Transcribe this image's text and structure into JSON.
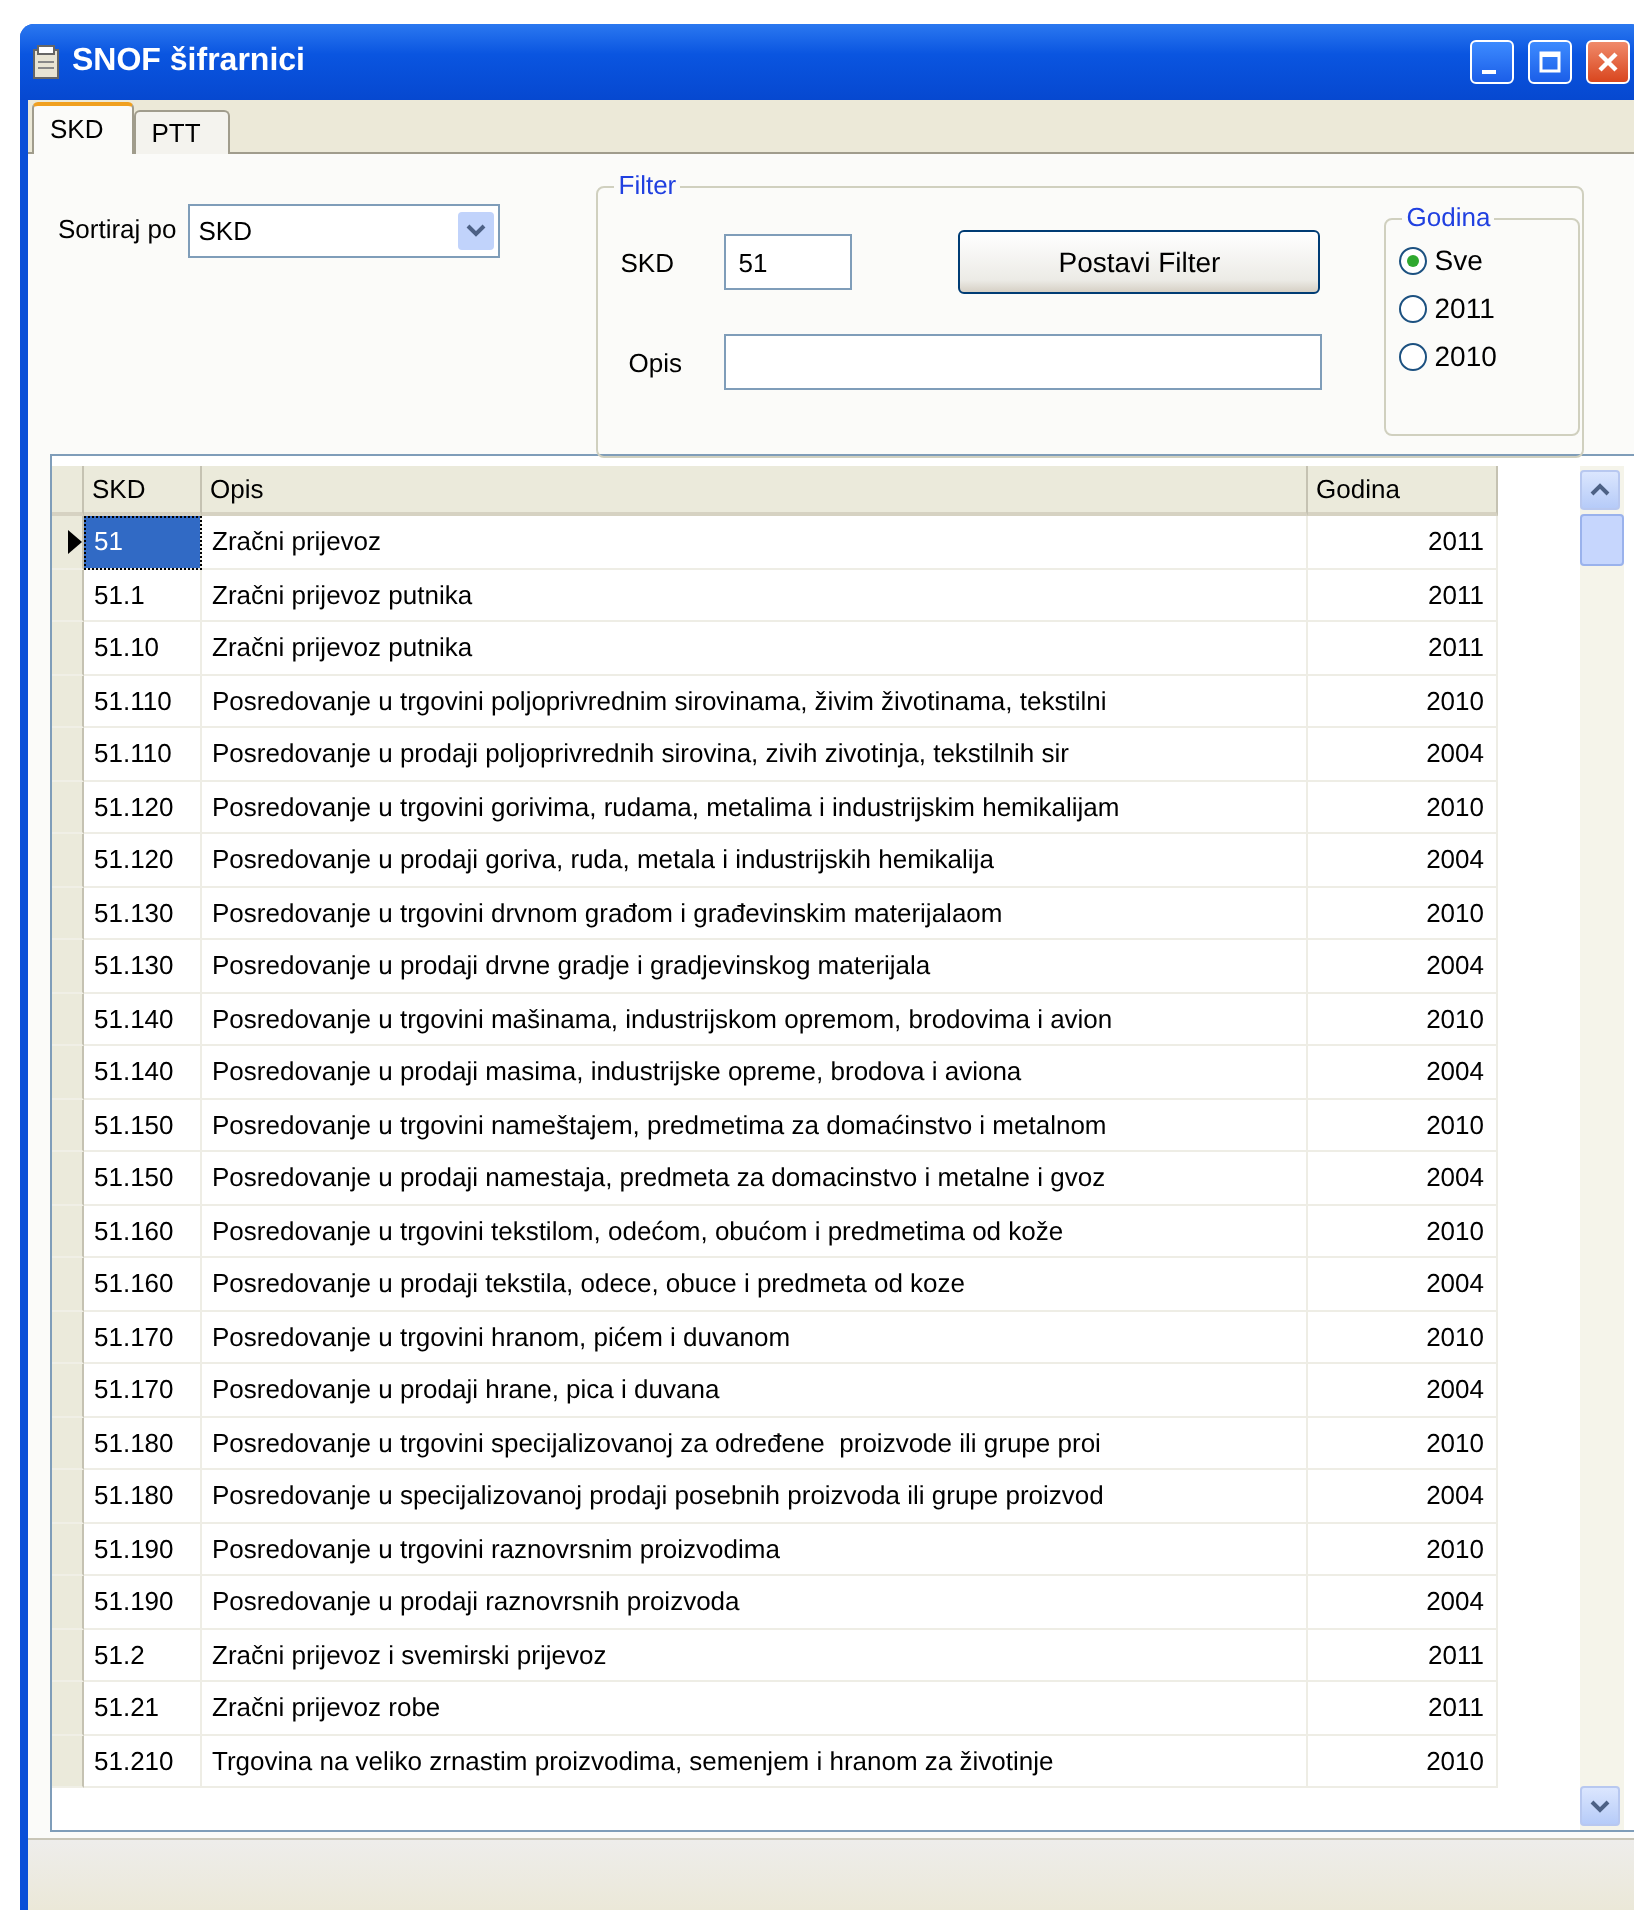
{
  "window": {
    "title": "SNOF šifrarnici"
  },
  "tabs": [
    {
      "label": "SKD",
      "selected": true
    },
    {
      "label": "PTT",
      "selected": false
    }
  ],
  "sort": {
    "label": "Sortiraj po",
    "value": "SKD"
  },
  "filter": {
    "title": "Filter",
    "skd_label": "SKD",
    "skd_value": "51",
    "opis_label": "Opis",
    "button": "Postavi Filter"
  },
  "year": {
    "title": "Godina",
    "options": [
      {
        "label": "Sve",
        "selected": true
      },
      {
        "label": "2011",
        "selected": false
      },
      {
        "label": "2010",
        "selected": false
      }
    ]
  },
  "table": {
    "columns": [
      "SKD",
      "Opis",
      "Godina"
    ],
    "rows": [
      {
        "skd": "51",
        "opis": "Zračni prijevoz",
        "godina": "2011",
        "selected": true
      },
      {
        "skd": "51.1",
        "opis": "Zračni prijevoz putnika",
        "godina": "2011",
        "selected": false
      },
      {
        "skd": "51.10",
        "opis": "Zračni prijevoz putnika",
        "godina": "2011",
        "selected": false
      },
      {
        "skd": "51.110",
        "opis": "Posredovanje u trgovini poljoprivrednim sirovinama, živim životinama, tekstilni",
        "godina": "2010",
        "selected": false
      },
      {
        "skd": "51.110",
        "opis": "Posredovanje u prodaji poljoprivrednih sirovina, zivih zivotinja, tekstilnih sir",
        "godina": "2004",
        "selected": false
      },
      {
        "skd": "51.120",
        "opis": "Posredovanje u trgovini gorivima, rudama, metalima i industrijskim hemikalijam",
        "godina": "2010",
        "selected": false
      },
      {
        "skd": "51.120",
        "opis": "Posredovanje u prodaji goriva, ruda, metala i industrijskih hemikalija",
        "godina": "2004",
        "selected": false
      },
      {
        "skd": "51.130",
        "opis": "Posredovanje u trgovini drvnom građom i građevinskim materijalaom",
        "godina": "2010",
        "selected": false
      },
      {
        "skd": "51.130",
        "opis": "Posredovanje u prodaji drvne gradje i gradjevinskog materijala",
        "godina": "2004",
        "selected": false
      },
      {
        "skd": "51.140",
        "opis": "Posredovanje u trgovini mašinama, industrijskom opremom, brodovima i avion",
        "godina": "2010",
        "selected": false
      },
      {
        "skd": "51.140",
        "opis": "Posredovanje u prodaji masima, industrijske opreme, brodova i aviona",
        "godina": "2004",
        "selected": false
      },
      {
        "skd": "51.150",
        "opis": "Posredovanje u trgovini nameštajem, predmetima za domaćinstvo i metalnom",
        "godina": "2010",
        "selected": false
      },
      {
        "skd": "51.150",
        "opis": "Posredovanje u prodaji namestaja, predmeta za domacinstvo i metalne i gvoz",
        "godina": "2004",
        "selected": false
      },
      {
        "skd": "51.160",
        "opis": "Posredovanje u trgovini tekstilom, odećom, obućom i predmetima od kože",
        "godina": "2010",
        "selected": false
      },
      {
        "skd": "51.160",
        "opis": "Posredovanje u prodaji tekstila, odece, obuce i predmeta od koze",
        "godina": "2004",
        "selected": false
      },
      {
        "skd": "51.170",
        "opis": "Posredovanje u trgovini hranom, pićem i duvanom",
        "godina": "2010",
        "selected": false
      },
      {
        "skd": "51.170",
        "opis": "Posredovanje u prodaji hrane, pica i duvana",
        "godina": "2004",
        "selected": false
      },
      {
        "skd": "51.180",
        "opis": "Posredovanje u trgovini specijalizovanoj za određene  proizvode ili grupe proi",
        "godina": "2010",
        "selected": false
      },
      {
        "skd": "51.180",
        "opis": "Posredovanje u specijalizovanoj prodaji posebnih proizvoda ili grupe proizvod",
        "godina": "2004",
        "selected": false
      },
      {
        "skd": "51.190",
        "opis": "Posredovanje u trgovini raznovrsnim proizvodima",
        "godina": "2010",
        "selected": false
      },
      {
        "skd": "51.190",
        "opis": "Posredovanje u prodaji raznovrsnih proizvoda",
        "godina": "2004",
        "selected": false
      },
      {
        "skd": "51.2",
        "opis": "Zračni prijevoz i svemirski prijevoz",
        "godina": "2011",
        "selected": false
      },
      {
        "skd": "51.21",
        "opis": "Zračni prijevoz robe",
        "godina": "2011",
        "selected": false
      },
      {
        "skd": "51.210",
        "opis": "Trgovina na veliko zrnastim proizvodima, semenjem i hranom za životinje",
        "godina": "2010",
        "selected": false
      }
    ]
  }
}
